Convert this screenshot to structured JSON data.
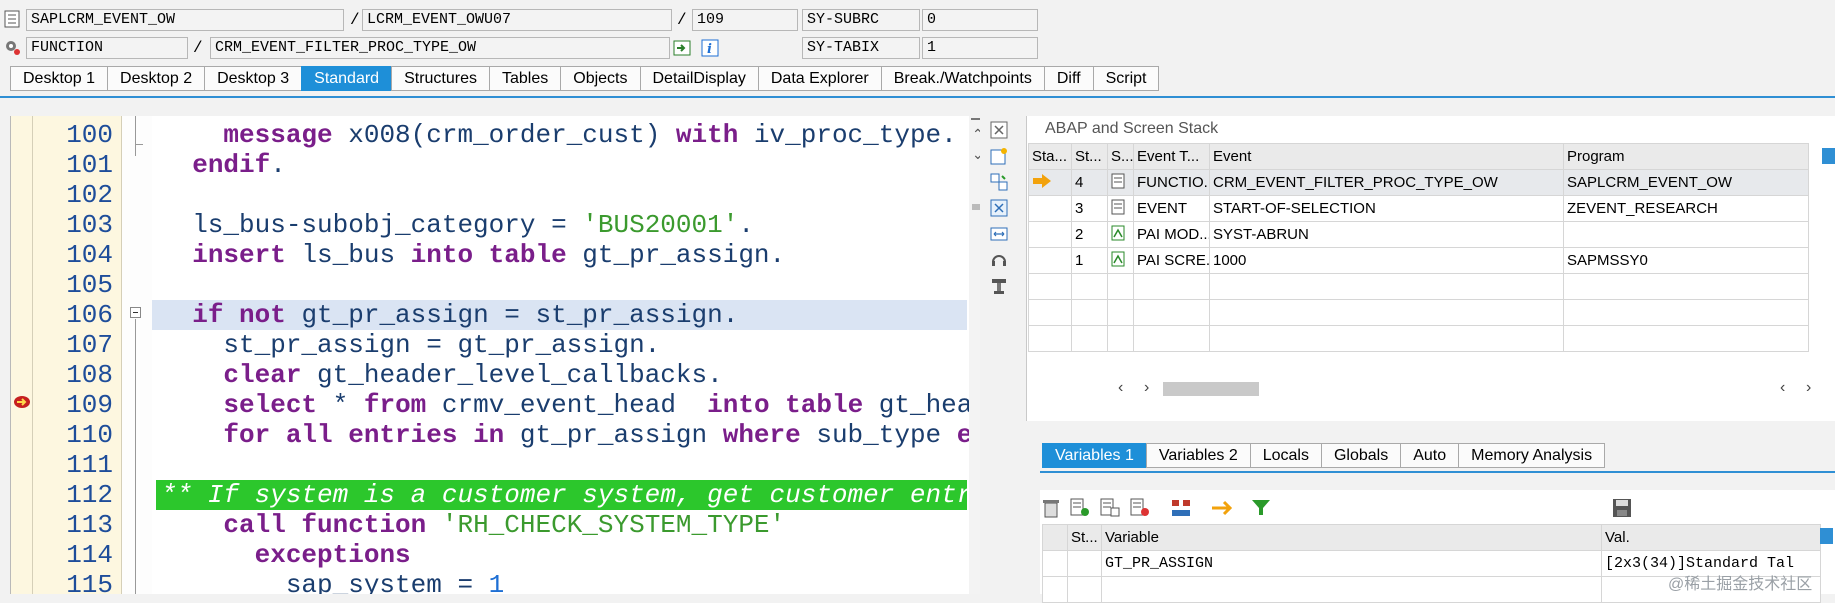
{
  "header": {
    "program": "SAPLCRM_EVENT_OW",
    "include": "LCRM_EVENT_OWU07",
    "line": "109",
    "subrc_label": "SY-SUBRC",
    "subrc_value": "0",
    "type": "FUNCTION",
    "name": "CRM_EVENT_FILTER_PROC_TYPE_OW",
    "tabix_label": "SY-TABIX",
    "tabix_value": "1",
    "slash": "/"
  },
  "tabs": [
    "Desktop 1",
    "Desktop 2",
    "Desktop 3",
    "Standard",
    "Structures",
    "Tables",
    "Objects",
    "DetailDisplay",
    "Data Explorer",
    "Break./Watchpoints",
    "Diff",
    "Script"
  ],
  "active_tab": "Standard",
  "code": {
    "lines": [
      {
        "n": "100",
        "t": "    message x008(crm_order_cust) with iv_proc_type."
      },
      {
        "n": "101",
        "t": "  endif."
      },
      {
        "n": "102",
        "t": ""
      },
      {
        "n": "103",
        "t": "  ls_bus-subobj_category = 'BUS20001'."
      },
      {
        "n": "104",
        "t": "  insert ls_bus into table gt_pr_assign."
      },
      {
        "n": "105",
        "t": ""
      },
      {
        "n": "106",
        "t": "  if not gt_pr_assign = st_pr_assign."
      },
      {
        "n": "107",
        "t": "    st_pr_assign = gt_pr_assign."
      },
      {
        "n": "108",
        "t": "    clear gt_header_level_callbacks."
      },
      {
        "n": "109",
        "t": "    select * from crmv_event_head  into table gt_hea"
      },
      {
        "n": "110",
        "t": "    for all entries in gt_pr_assign where sub_type e"
      },
      {
        "n": "111",
        "t": ""
      },
      {
        "n": "112",
        "t": "** If system is a customer system, get customer entrie"
      },
      {
        "n": "113",
        "t": "    call function 'RH_CHECK_SYSTEM_TYPE'"
      },
      {
        "n": "114",
        "t": "      exceptions"
      },
      {
        "n": "115",
        "t": "        sap_system = 1"
      }
    ]
  },
  "stack": {
    "title": "ABAP and Screen Stack",
    "columns": [
      "Sta...",
      "St...",
      "S...",
      "Event T...",
      "Event",
      "Program"
    ],
    "rows": [
      {
        "level": "4",
        "type": "FUNCTIO...",
        "event": "CRM_EVENT_FILTER_PROC_TYPE_OW",
        "program": "SAPLCRM_EVENT_OW"
      },
      {
        "level": "3",
        "type": "EVENT",
        "event": "START-OF-SELECTION",
        "program": "ZEVENT_RESEARCH"
      },
      {
        "level": "2",
        "type": "PAI MOD...",
        "event": "SYST-ABRUN",
        "program": ""
      },
      {
        "level": "1",
        "type": "PAI SCRE...",
        "event": "1000",
        "program": "SAPMSSY0"
      }
    ]
  },
  "variables": {
    "tabs": [
      "Variables 1",
      "Variables 2",
      "Locals",
      "Globals",
      "Auto",
      "Memory Analysis"
    ],
    "active": "Variables 1",
    "columns": [
      "St...",
      "Variable",
      "Val."
    ],
    "rows": [
      {
        "variable": "GT_PR_ASSIGN",
        "value": "[2x3(34)]Standard Tal"
      }
    ]
  },
  "watermark": "@稀土掘金技术社区"
}
